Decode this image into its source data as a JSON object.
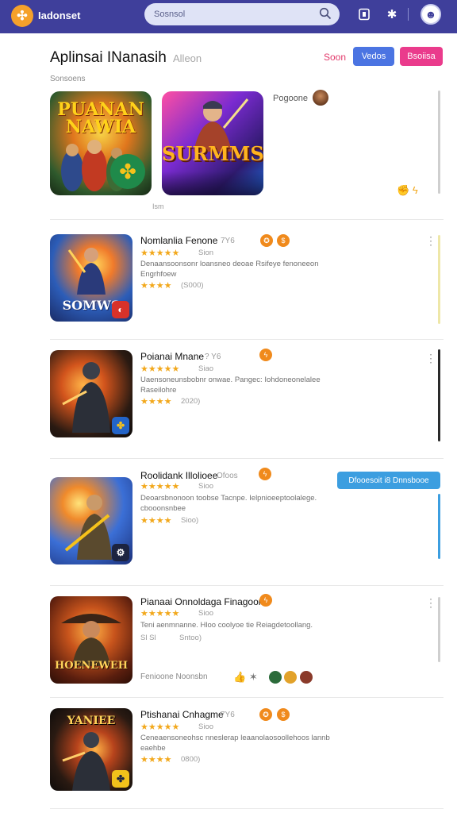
{
  "topbar": {
    "brand": "Iadonset",
    "search_value": "Sosnsol",
    "icons": [
      "logo-icon",
      "search-icon",
      "bookmark-icon",
      "puzzle-icon",
      "profile-icon"
    ]
  },
  "header": {
    "title": "Aplinsai INanasih",
    "subtitle": "Alleon",
    "link": "Soon",
    "btn_primary": "Vedos",
    "btn_secondary": "Bsoiisa"
  },
  "section_label": "Sonsoens",
  "featured": {
    "caption": "Pogoone",
    "tiny_label": "Ism",
    "games": [
      {
        "title": "PUANAN NAWIA",
        "image_label": ""
      },
      {
        "title": "SURMMS",
        "image_label": ""
      }
    ]
  },
  "apps": [
    {
      "title": "Nomlanlia Fenone",
      "title_extra": "7Y6",
      "rating_text": "Sion",
      "desc": "Denaansoonsonr loansneo deoae Rsifeye fenoneeon Engrhfoew",
      "stars2_text": "(S000)",
      "thumb_text": "SOMWS"
    },
    {
      "title": "Poianai Mnane",
      "title_extra": "? Y6",
      "rating_text": "Siao",
      "desc": "Uaensoneunsbobnr onwae. Pangec: Iohdoneonelalee Raseilohre",
      "stars2_text": "2020)",
      "thumb_text": ""
    },
    {
      "title": "Roolidank Illolioee",
      "title_extra": "Ofoos",
      "rating_text": "Sioo",
      "desc": "Deoarsbnonoon toobse Tacnpe. Ielpnioeeptoolalege. cbooonsnbee",
      "stars2_text": "Sioo)",
      "thumb_text": "",
      "cta": "Dfooesoit i8 Dnnsbooe"
    },
    {
      "title": "Pianaai Onnoldaga Finagoon",
      "title_extra": "",
      "rating_text": "Sioo",
      "desc": "Teni aenmnanne. Hloo coolyoe tie Reiagdetoollang.",
      "stars2_text": "Sntoo)",
      "stars2_prefix": "Sl Sl",
      "thumb_text": "HOENEWEH",
      "footer_text": "Fenioone Noonsbn"
    },
    {
      "title": "Ptishanai Cnhagme",
      "title_extra": "7Y6",
      "rating_text": "Sioo",
      "desc": "Ceneaensoneohsc nneslerap leaanolaosoollehoos lannb eaehbe",
      "stars2_text": "0800)",
      "thumb_text": "YANIEE"
    }
  ],
  "colors": {
    "topbar": "#3f3f9b",
    "accent_blue": "#4b74e2",
    "accent_pink": "#ea3b8c",
    "star": "#f2a81c",
    "cta": "#3c9ee0"
  }
}
